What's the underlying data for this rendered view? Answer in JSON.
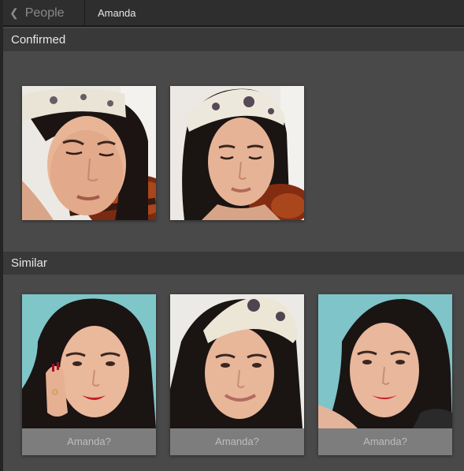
{
  "header": {
    "back_label": "People",
    "breadcrumb": "Amanda"
  },
  "confirmed": {
    "title": "Confirmed",
    "photos": [
      {
        "alt": "face-photo"
      },
      {
        "alt": "face-photo"
      }
    ]
  },
  "similar": {
    "title": "Similar",
    "photos": [
      {
        "caption": "Amanda?"
      },
      {
        "caption": "Amanda?"
      },
      {
        "caption": "Amanda?"
      }
    ]
  },
  "icons": {
    "back": "chevron-left-icon"
  }
}
